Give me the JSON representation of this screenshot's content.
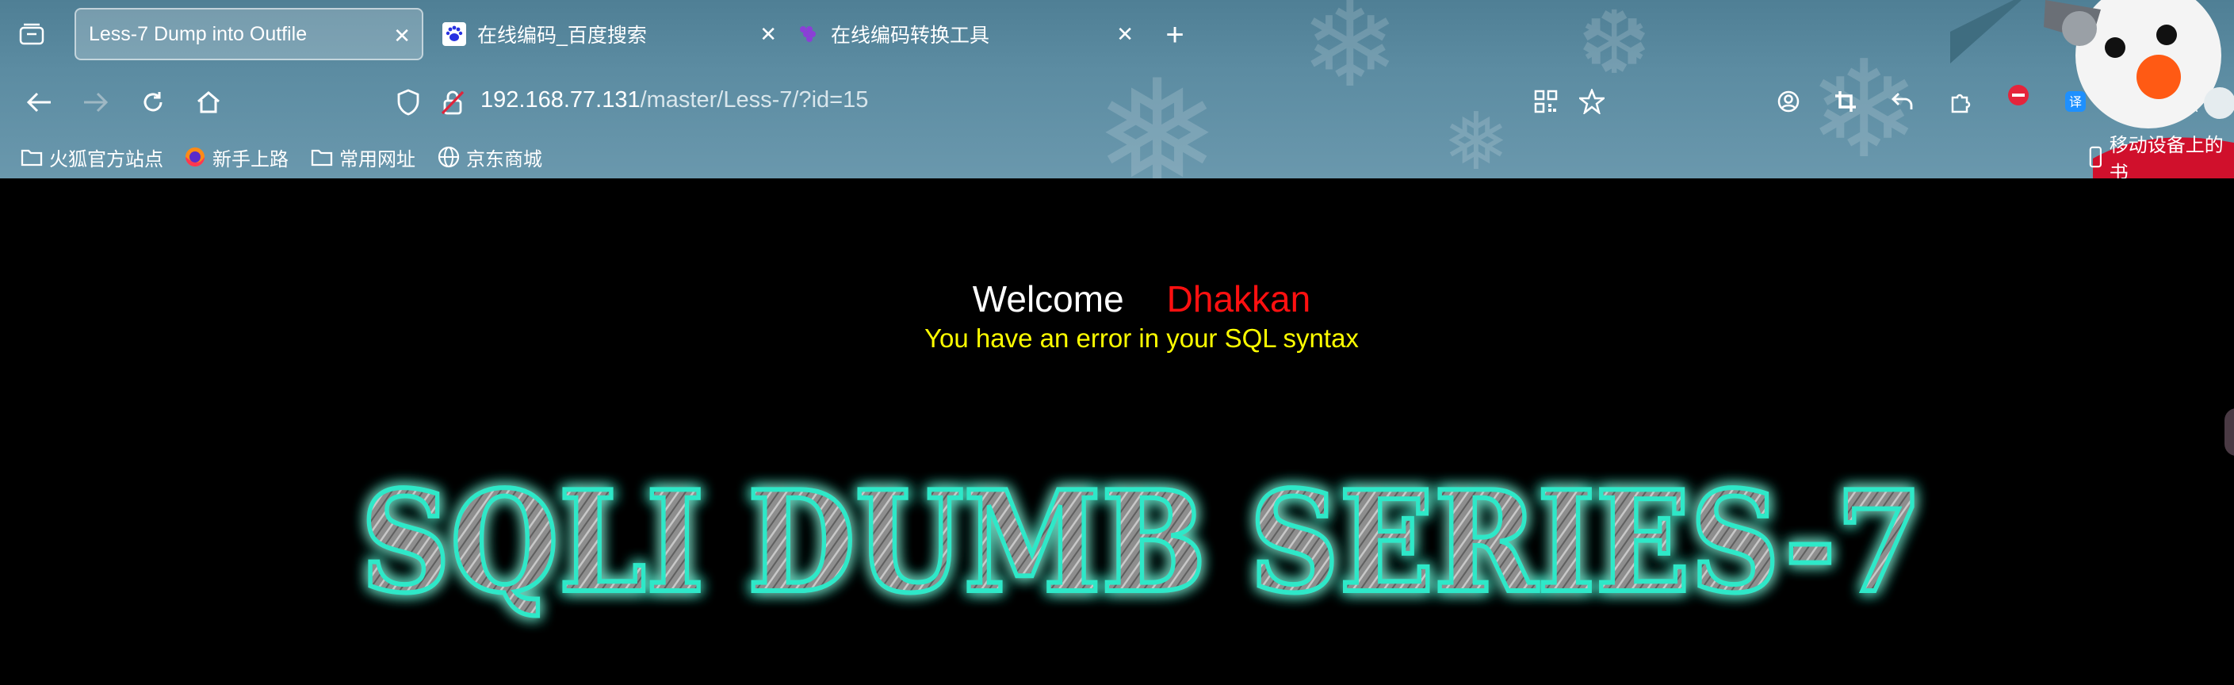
{
  "browser": {
    "tabs": [
      {
        "label": "Less-7 Dump into Outfile",
        "active": true,
        "icon": "none"
      },
      {
        "label": "在线编码_百度搜索",
        "active": false,
        "icon": "baidu-icon"
      },
      {
        "label": "在线编码转换工具",
        "active": false,
        "icon": "grape-icon"
      }
    ],
    "url": {
      "host": "192.168.77.131",
      "path": "/master/Less-7/?id=15"
    },
    "bookmarks": [
      {
        "label": "火狐官方站点",
        "icon": "folder-icon"
      },
      {
        "label": "新手上路",
        "icon": "firefox-icon"
      },
      {
        "label": "常用网址",
        "icon": "folder-icon"
      },
      {
        "label": "京东商城",
        "icon": "globe-icon"
      }
    ],
    "mobile_bookmarks": "移动设备上的书"
  },
  "page": {
    "welcome": "Welcome",
    "user": "Dhakkan",
    "error": "You have an error in your SQL syntax",
    "banner": "SQLI DUMB SERIES-7"
  },
  "colors": {
    "chrome": "#5c8ca2",
    "background": "#000000",
    "user": "#ff1010",
    "error": "#ffff00",
    "glow": "#2ee8c8"
  }
}
